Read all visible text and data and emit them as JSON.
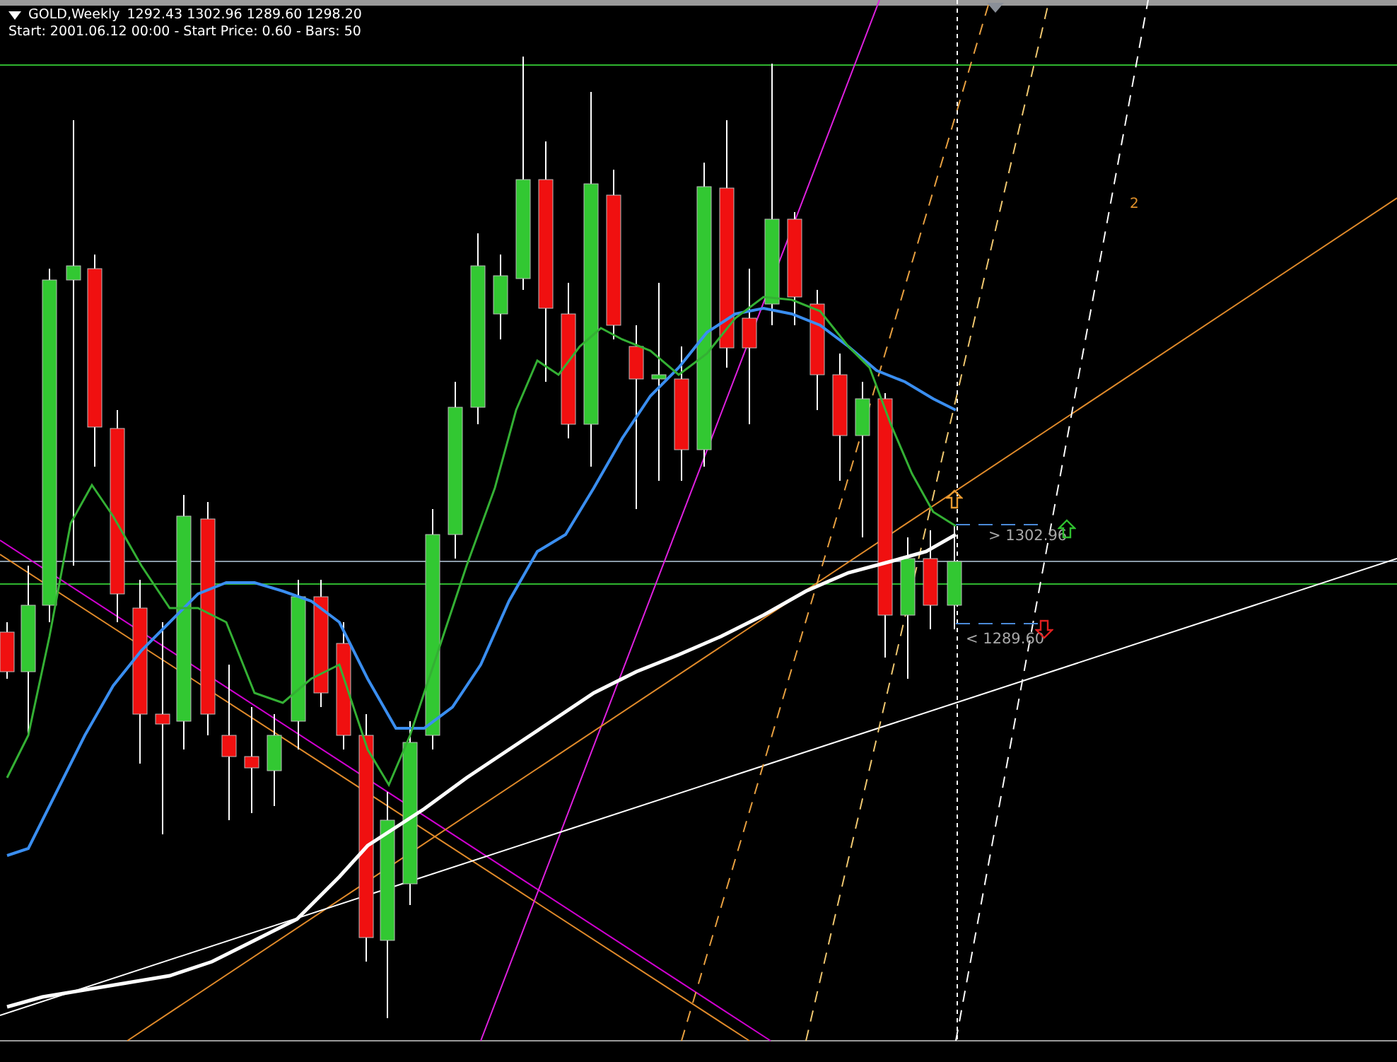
{
  "chart_header": {
    "symbol": "GOLD,Weekly",
    "quote": "1292.43 1302.96 1289.60 1298.20",
    "info": "Start: 2001.06.12 00:00 - Start Price: 0.60 - Bars: 50"
  },
  "price_labels": [
    {
      "kind": "buy",
      "text": "> 1302.96"
    },
    {
      "kind": "sell",
      "text": "< 1289.60"
    }
  ],
  "channel_label": "2"
}
